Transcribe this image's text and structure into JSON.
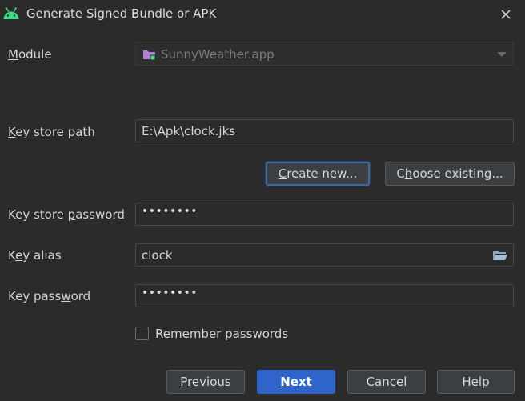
{
  "window": {
    "title": "Generate Signed Bundle or APK",
    "app_icon": "android-icon",
    "close_icon": "close-icon"
  },
  "module": {
    "label_accel": "M",
    "label_rest": "odule",
    "value": "SunnyWeather.app"
  },
  "key_store_path": {
    "label_accel": "K",
    "label_rest": "ey store path",
    "value": "E:\\Apk\\clock.jks"
  },
  "buttons": {
    "create_new_accel": "C",
    "create_new_rest": "reate new...",
    "choose_existing_pre": "C",
    "choose_existing_accel": "h",
    "choose_existing_rest": "oose existing..."
  },
  "key_store_password": {
    "label_pre": "Key store ",
    "label_accel": "p",
    "label_rest": "assword",
    "value": "••••••••"
  },
  "key_alias": {
    "label_pre": "K",
    "label_accel": "e",
    "label_rest": "y alias",
    "value": "clock"
  },
  "key_password": {
    "label_pre": "Key pass",
    "label_accel": "w",
    "label_rest": "ord",
    "value": "••••••••"
  },
  "remember": {
    "accel": "R",
    "rest": "emember passwords",
    "checked": false
  },
  "footer": {
    "previous_accel": "P",
    "previous_rest": "revious",
    "next_accel": "N",
    "next_rest": "ext",
    "cancel": "Cancel",
    "help": "Help"
  },
  "colors": {
    "background": "#2b2b2b",
    "primary_button": "#2f65ca",
    "focus_border": "#3f6a9e",
    "android_green": "#3ddc84"
  }
}
